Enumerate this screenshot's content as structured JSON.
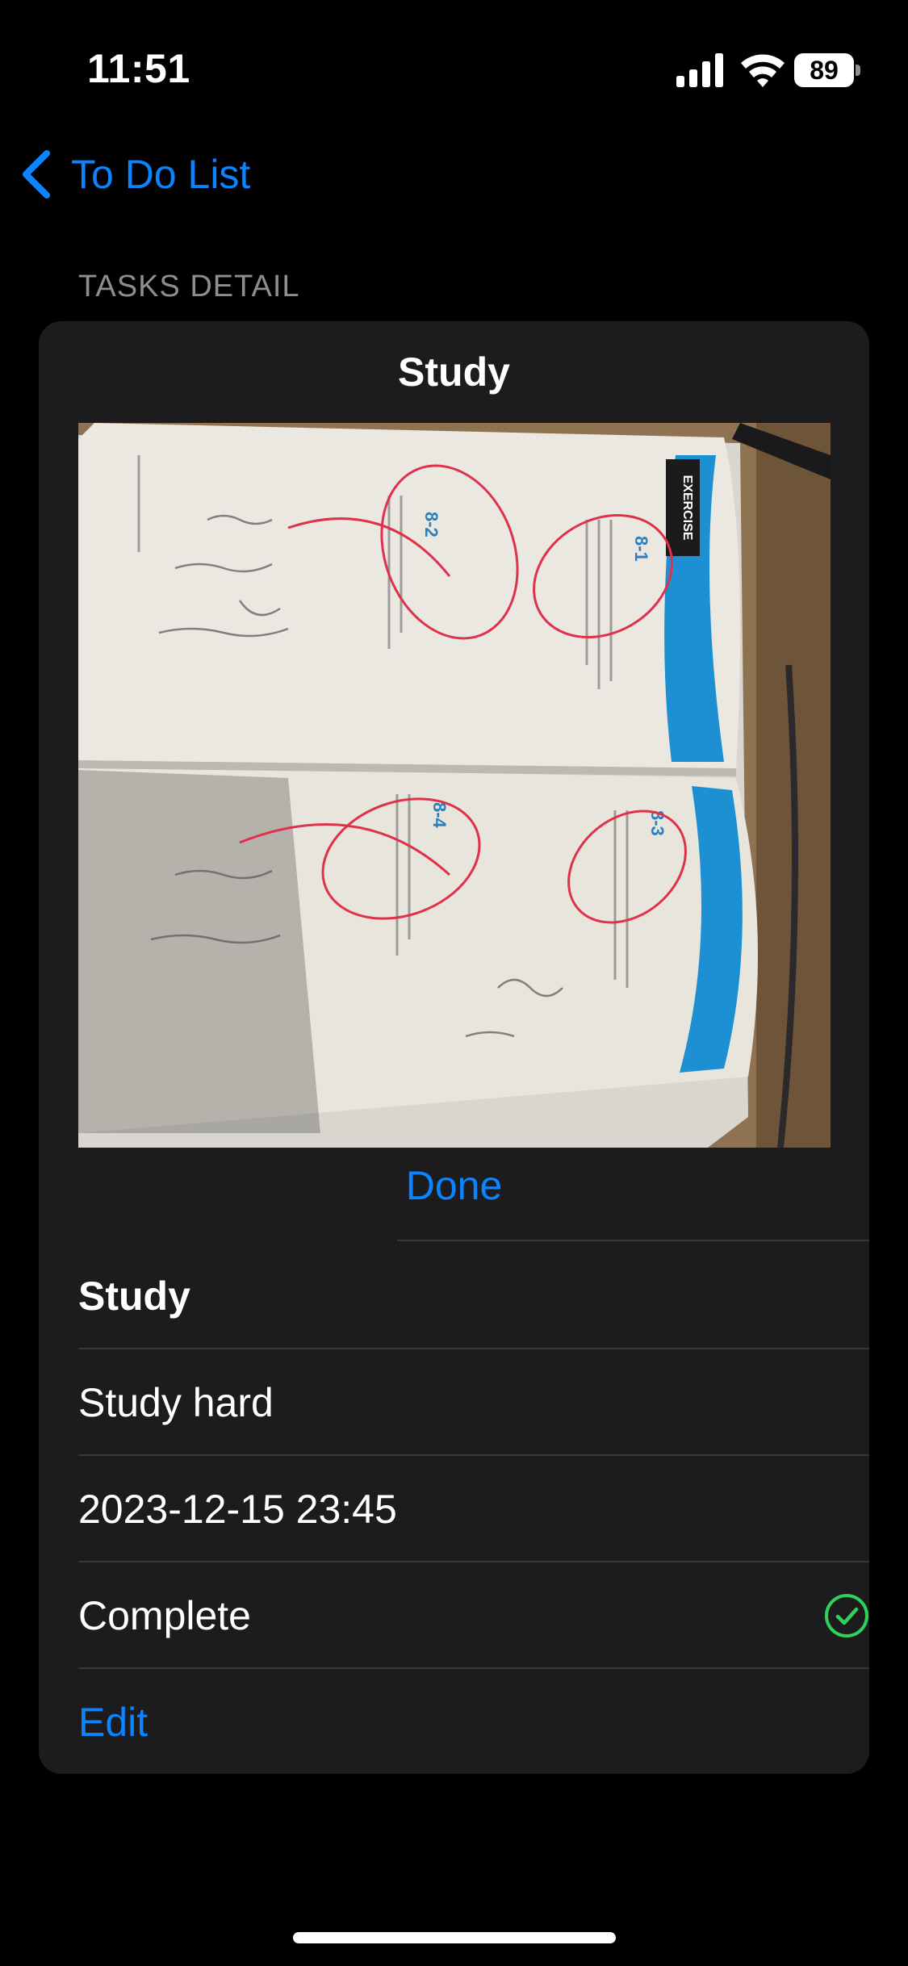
{
  "status_bar": {
    "time": "11:51",
    "battery": "89",
    "icons": [
      "signal-icon",
      "wifi-icon",
      "battery-icon"
    ]
  },
  "nav": {
    "back_label": "To Do List",
    "back_icon": "chevron-left-icon"
  },
  "section_header": "TASKS DETAIL",
  "task": {
    "header_title": "Study",
    "photo": "open math workbook with exercises 8-1 to 8-4 on a wooden desk",
    "done_label": "Done",
    "title": "Study",
    "description": "Study hard",
    "due_date": "2023-12-15 23:45",
    "status": "Complete",
    "status_icon": "checkmark-circle-icon",
    "edit_label": "Edit"
  },
  "photo_text": {
    "exercise": "EXERCISE",
    "n1": "8-1",
    "n2": "8-2",
    "n3": "8-3",
    "n4": "8-4"
  },
  "colors": {
    "accent": "#0a84ff",
    "success": "#30d158",
    "card": "#1c1c1e",
    "background": "#000000"
  }
}
